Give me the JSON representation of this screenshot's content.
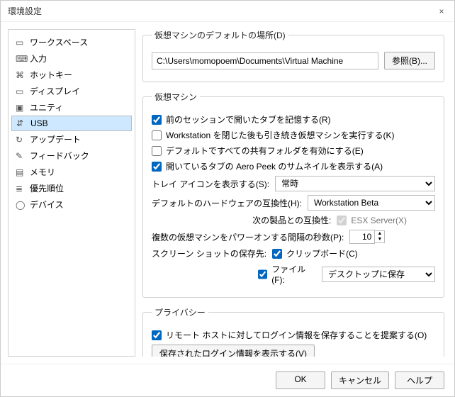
{
  "window": {
    "title": "環境設定",
    "close": "×"
  },
  "sidebar": {
    "items": [
      {
        "label": "ワークスペース"
      },
      {
        "label": "入力"
      },
      {
        "label": "ホットキー"
      },
      {
        "label": "ディスプレイ"
      },
      {
        "label": "ユニティ"
      },
      {
        "label": "USB"
      },
      {
        "label": "アップデート"
      },
      {
        "label": "フィードバック"
      },
      {
        "label": "メモリ"
      },
      {
        "label": "優先順位"
      },
      {
        "label": "デバイス"
      }
    ],
    "selected_index": 5
  },
  "groups": {
    "defaultLocation": {
      "legend": "仮想マシンのデフォルトの場所(D)",
      "path": "C:\\Users\\momopoem\\Documents\\Virtual Machine",
      "browse": "参照(B)..."
    },
    "vm": {
      "legend": "仮想マシン",
      "chk_remember": "前のセッションで開いたタブを記憶する(R)",
      "chk_keep_running": "Workstation を閉じた後も引き続き仮想マシンを実行する(K)",
      "chk_enable_shared": "デフォルトですべての共有フォルダを有効にする(E)",
      "chk_aero": "開いているタブの Aero Peek のサムネイルを表示する(A)",
      "tray_label": "トレイ アイコンを表示する(S):",
      "tray_value": "常時",
      "compat_label": "デフォルトのハードウェアの互換性(H):",
      "compat_value": "Workstation Beta",
      "compat_with_label": "次の製品との互換性:",
      "esx_label": "ESX Server(X)",
      "poweron_label": "複数の仮想マシンをパワーオンする間隔の秒数(P):",
      "poweron_value": "10",
      "screenshot_label": "スクリーン ショットの保存先:",
      "clip_label": "クリップボード(C)",
      "file_label": "ファイル(F):",
      "file_dest": "デスクトップに保存"
    },
    "privacy": {
      "legend": "プライバシー",
      "chk_offer": "リモート ホストに対してログイン情報を保存することを提案する(O)",
      "show_saved": "保存されたログイン情報を表示する(V)"
    }
  },
  "checks": {
    "remember": true,
    "keep": false,
    "shared": false,
    "aero": true,
    "esx": true,
    "clip": true,
    "file": true,
    "offer": true
  },
  "footer": {
    "ok": "OK",
    "cancel": "キャンセル",
    "help": "ヘルプ"
  }
}
